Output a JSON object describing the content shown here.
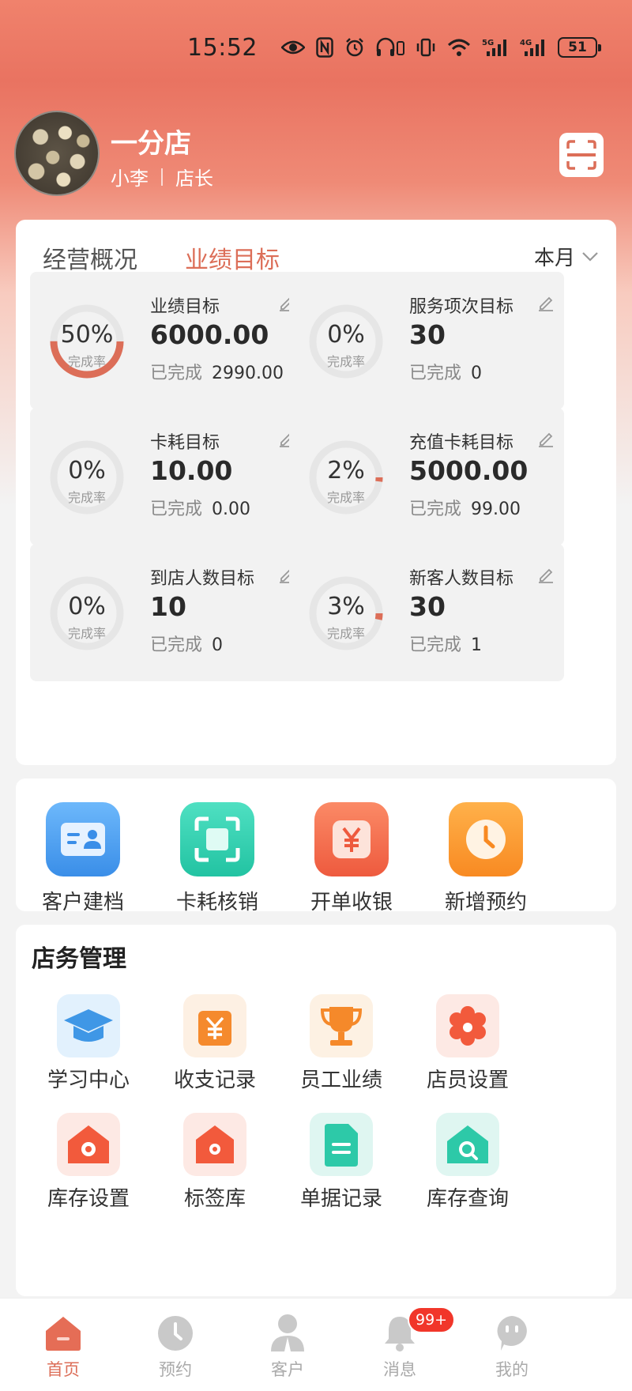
{
  "status_bar": {
    "time": "15:52",
    "network_1": "5G",
    "network_2": "4G",
    "battery": "51"
  },
  "header": {
    "shop_name": "一分店",
    "user_name": "小李",
    "role": "店长"
  },
  "performance": {
    "tabs": [
      "经营概况",
      "业绩目标"
    ],
    "active_tab": 1,
    "period": "本月",
    "completion_label": "完成率",
    "done_label": "已完成",
    "metrics": [
      {
        "title": "业绩目标",
        "target": "6000.00",
        "done": "2990.00",
        "percent_text": "50%",
        "percent": 50
      },
      {
        "title": "服务项次目标",
        "target": "30",
        "done": "0",
        "percent_text": "0%",
        "percent": 0
      },
      {
        "title": "卡耗目标",
        "target": "10.00",
        "done": "0.00",
        "percent_text": "0%",
        "percent": 0
      },
      {
        "title": "充值卡耗目标",
        "target": "5000.00",
        "done": "99.00",
        "percent_text": "2%",
        "percent": 2
      },
      {
        "title": "到店人数目标",
        "target": "10",
        "done": "0",
        "percent_text": "0%",
        "percent": 0
      },
      {
        "title": "新客人数目标",
        "target": "30",
        "done": "1",
        "percent_text": "3%",
        "percent": 3
      }
    ]
  },
  "quick_actions": [
    {
      "label": "客户建档",
      "icon": "customer-card-icon",
      "color": "#4a9ff0"
    },
    {
      "label": "卡耗核销",
      "icon": "scan-verify-icon",
      "color": "#2ccfae"
    },
    {
      "label": "开单收银",
      "icon": "yen-checkout-icon",
      "color": "#f4684a"
    },
    {
      "label": "新增预约",
      "icon": "clock-icon",
      "color": "#fb9a34"
    }
  ],
  "store_management": {
    "title": "店务管理",
    "items": [
      {
        "label": "学习中心",
        "icon": "graduation-cap-icon"
      },
      {
        "label": "收支记录",
        "icon": "yen-ledger-icon"
      },
      {
        "label": "员工业绩",
        "icon": "trophy-icon"
      },
      {
        "label": "店员设置",
        "icon": "flower-gear-icon"
      },
      {
        "label": "库存设置",
        "icon": "warehouse-gear-icon"
      },
      {
        "label": "标签库",
        "icon": "tag-house-icon"
      },
      {
        "label": "单据记录",
        "icon": "document-icon"
      },
      {
        "label": "库存查询",
        "icon": "warehouse-search-icon"
      }
    ]
  },
  "bottom_nav": {
    "items": [
      "首页",
      "预约",
      "客户",
      "消息",
      "我的"
    ],
    "active": 0,
    "message_badge": "99+"
  },
  "colors": {
    "accent": "#dc6e58",
    "header_top": "#f0826c",
    "badge": "#f1362a"
  }
}
